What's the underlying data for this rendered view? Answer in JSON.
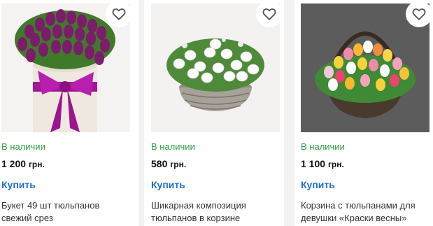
{
  "products": [
    {
      "status": "В наличии",
      "price": "1 200",
      "currency": "грн.",
      "buy_label": "Купить",
      "title_line1": "Букет 49 шт тюльпанов",
      "title_line2": "свежий срез",
      "image": "purple-tulips-hatbox-image",
      "favorite_icon": "heart-icon"
    },
    {
      "status": "В наличии",
      "price": "580",
      "currency": "грн.",
      "buy_label": "Купить",
      "title_line1": "Шикарная композиция",
      "title_line2": "тюльпанов в корзине",
      "image": "white-tulips-basket-image",
      "favorite_icon": "heart-icon"
    },
    {
      "status": "В наличии",
      "price": "1 100",
      "currency": "грн.",
      "buy_label": "Купить",
      "title_line1": "Корзина с тюльпанами для",
      "title_line2": "девушки «Краски весны»",
      "image": "colorful-tulips-basket-image",
      "favorite_icon": "heart-icon"
    }
  ],
  "colors": {
    "in_stock": "#2e9e43",
    "buy_link": "#1f6fd1",
    "heart_outline": "#555555"
  }
}
